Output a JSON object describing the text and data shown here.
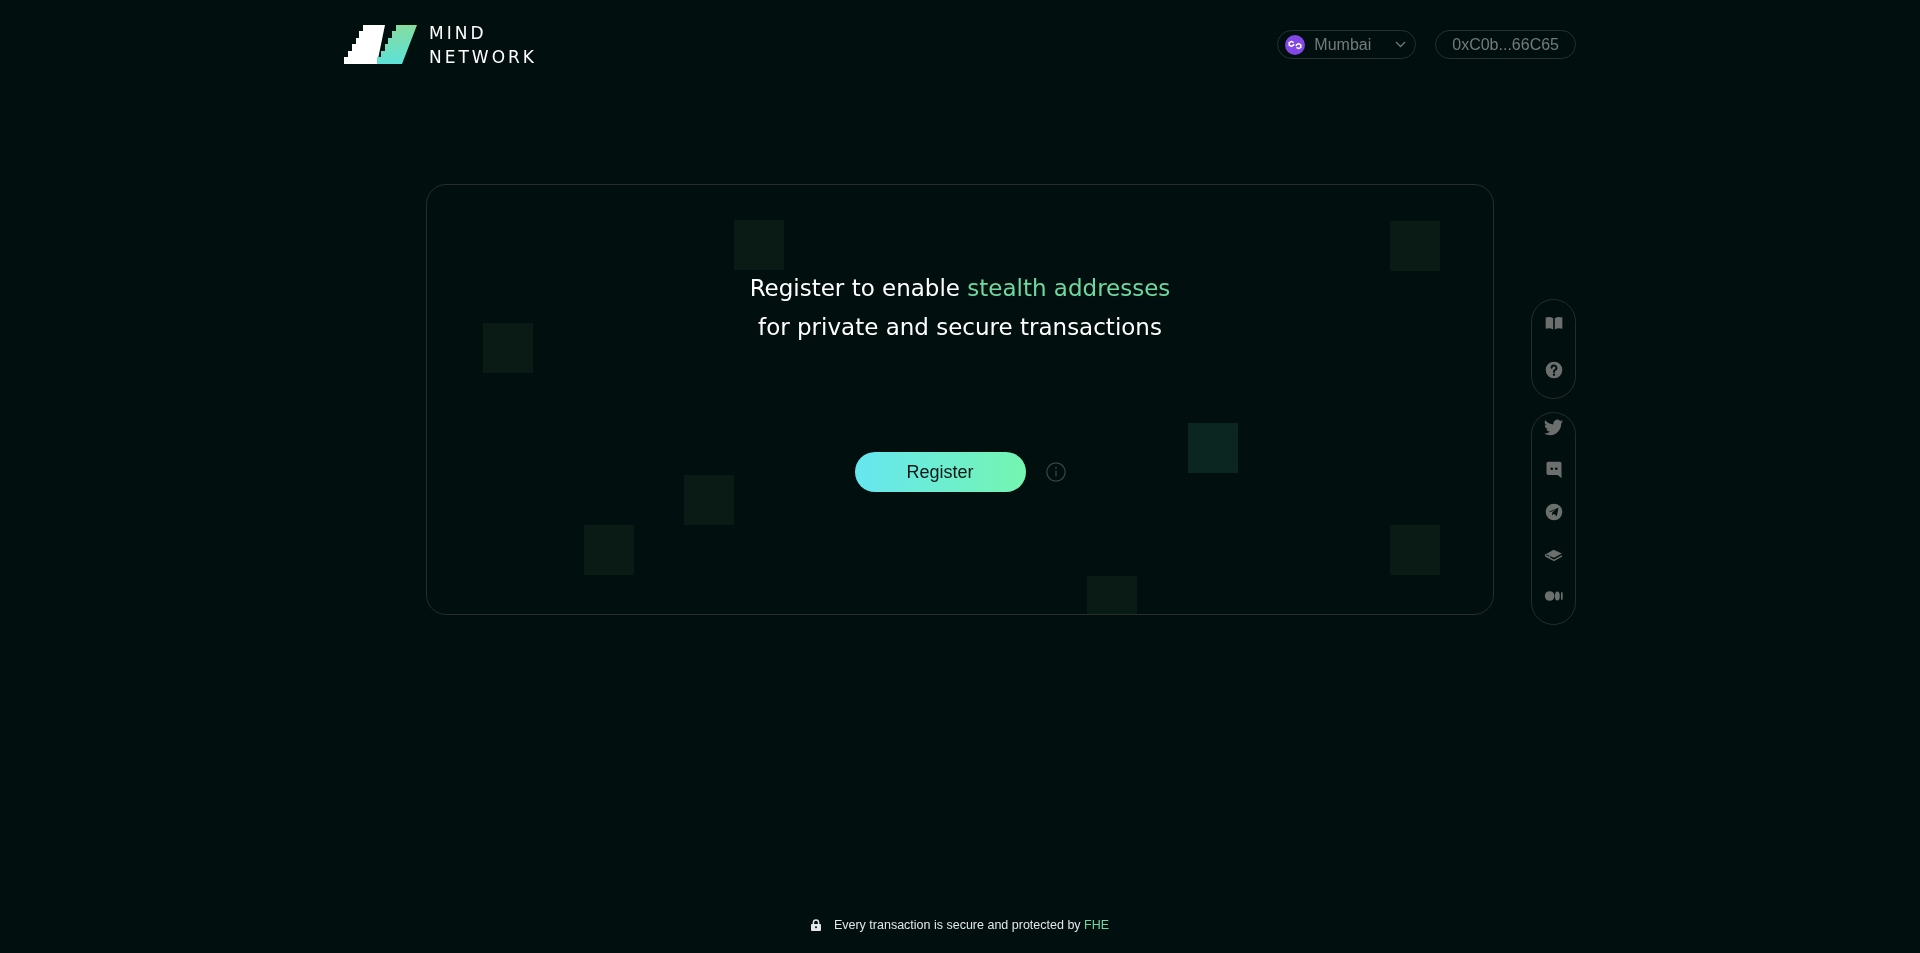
{
  "header": {
    "logo": {
      "lines": [
        "MIND",
        "NETWORK"
      ]
    },
    "network": {
      "name": "Mumbai"
    },
    "wallet": {
      "address": "0xC0b...66C65"
    }
  },
  "card": {
    "heading": {
      "lead": "Register to enable ",
      "highlight": "stealth addresses",
      "tail": "for private and secure transactions"
    },
    "register_button": {
      "label": "Register"
    }
  },
  "footer": {
    "text": "Every transaction is secure and protected by ",
    "highlight": "FHE"
  }
}
